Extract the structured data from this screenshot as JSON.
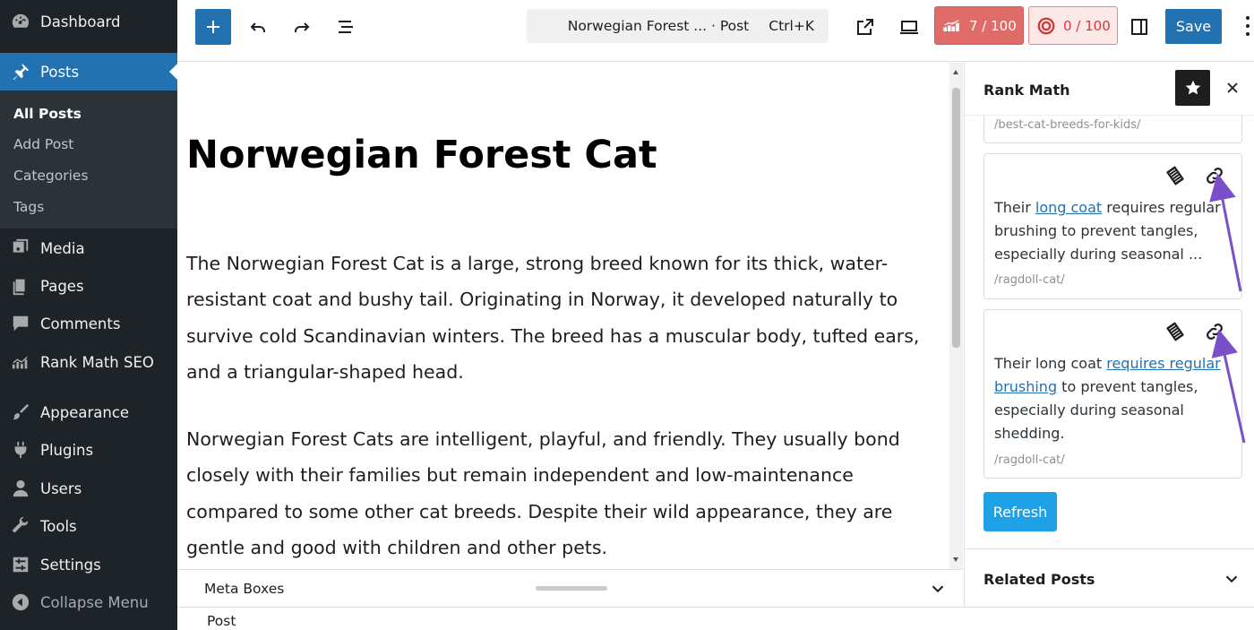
{
  "sidebar": {
    "items": [
      {
        "label": "Dashboard",
        "icon": "dashboard-icon"
      },
      {
        "label": "Posts",
        "icon": "pin-icon"
      },
      {
        "label": "Media",
        "icon": "media-icon"
      },
      {
        "label": "Pages",
        "icon": "pages-icon"
      },
      {
        "label": "Comments",
        "icon": "comment-icon"
      },
      {
        "label": "Rank Math SEO",
        "icon": "rankmath-icon"
      },
      {
        "label": "Appearance",
        "icon": "brush-icon"
      },
      {
        "label": "Plugins",
        "icon": "plug-icon"
      },
      {
        "label": "Users",
        "icon": "user-icon"
      },
      {
        "label": "Tools",
        "icon": "wrench-icon"
      },
      {
        "label": "Settings",
        "icon": "settings-icon"
      },
      {
        "label": "Collapse Menu",
        "icon": "collapse-icon"
      }
    ],
    "submenu": [
      "All Posts",
      "Add Post",
      "Categories",
      "Tags"
    ]
  },
  "toolbar": {
    "doc_title": "Norwegian Forest ... · Post",
    "shortcut": "Ctrl+K",
    "seo_score": "7 / 100",
    "content_score": "0 / 100",
    "save_label": "Save"
  },
  "post": {
    "title": "Norwegian Forest Cat",
    "paragraphs": [
      "The Norwegian Forest Cat is a large, strong breed known for its thick, water-resistant coat and bushy tail. Originating in Norway, it developed naturally to survive cold Scandinavian winters. The breed has a muscular body, tufted ears, and a triangular-shaped head.",
      "Norwegian Forest Cats are intelligent, playful, and friendly. They usually bond closely with their families but remain independent and low-maintenance compared to some other cat breeds. Despite their wild appearance, they are gentle and good with children and other pets."
    ]
  },
  "meta": {
    "label": "Meta Boxes",
    "breadcrumb": "Post"
  },
  "panel": {
    "title": "Rank Math",
    "cards": [
      {
        "url": "/best-cat-breeds-for-kids/"
      },
      {
        "pre": "Their ",
        "link": "long coat",
        "post": " requires regular brushing to prevent tangles, especially during seasonal ...",
        "url": "/ragdoll-cat/"
      },
      {
        "pre": "Their long coat ",
        "link": "requires regular brushing",
        "post": " to prevent tangles, especially during seasonal shedding.",
        "url": "/ragdoll-cat/"
      }
    ],
    "refresh_label": "Refresh",
    "related_title": "Related Posts"
  },
  "colors": {
    "sidebar_bg": "#1d2327",
    "accent": "#2271b1",
    "seo_score_bg": "#e06c69",
    "content_score_text": "#d63638",
    "arrow": "#7b4fc9"
  }
}
